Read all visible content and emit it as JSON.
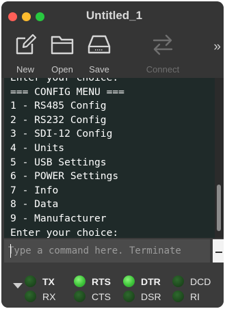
{
  "window": {
    "title": "Untitled_1"
  },
  "toolbar": {
    "new_label": "New",
    "open_label": "Open",
    "save_label": "Save",
    "connect_label": "Connect",
    "more_label": "»"
  },
  "terminal": {
    "lines": [
      "Enter your choice:",
      "=== CONFIG MENU ===",
      "1 - RS485 Config",
      "2 - RS232 Config",
      "3 - SDI-12 Config",
      "4 - Units",
      "5 - USB Settings",
      "6 - POWER Settings",
      "7 - Info",
      "8 - Data",
      "9 - Manufacturer",
      "Enter your choice:"
    ]
  },
  "command": {
    "value": "",
    "placeholder": "Type a command here. Terminate"
  },
  "signals": [
    {
      "label": "TX",
      "on": false
    },
    {
      "label": "RTS",
      "on": true
    },
    {
      "label": "DTR",
      "on": true
    },
    {
      "label": "DCD",
      "on": false
    },
    {
      "label": "RX",
      "on": false
    },
    {
      "label": "CTS",
      "on": false
    },
    {
      "label": "DSR",
      "on": false
    },
    {
      "label": "RI",
      "on": false
    }
  ],
  "colors": {
    "window_bg": "#3b3b3b",
    "terminal_bg": "#1f2a29",
    "terminal_text": "#ffffff",
    "led_on": "#3fc43a",
    "led_off": "#1d481d"
  }
}
